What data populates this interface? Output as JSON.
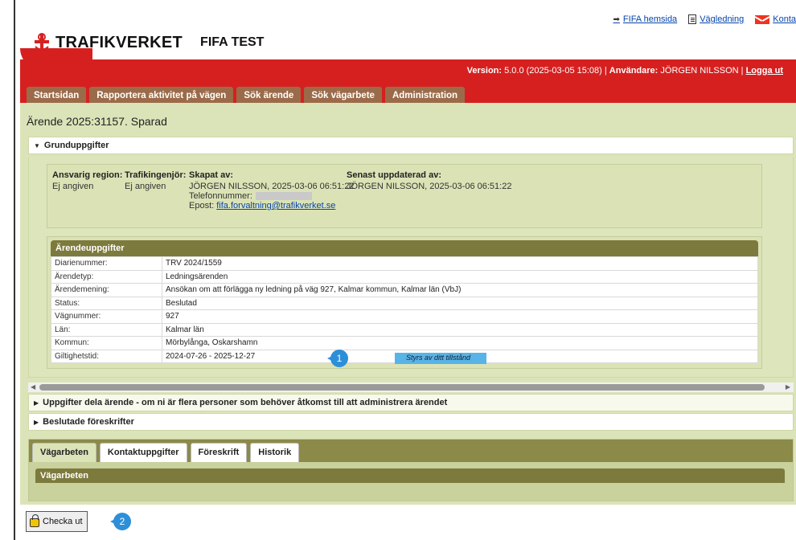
{
  "toplinks": {
    "home": "FIFA hemsida",
    "guide": "Vägledning",
    "contact": "Konta"
  },
  "brand": {
    "logo_text": "TRAFIKVERKET",
    "app_name": "FIFA TEST"
  },
  "header": {
    "version_label": "Version:",
    "version_value": "5.0.0 (2025-03-05 15:08)",
    "separator": "|",
    "user_label": "Användare:",
    "user_value": "JÖRGEN NILSSON",
    "logout": "Logga ut"
  },
  "nav": {
    "tabs": [
      "Startsidan",
      "Rapportera aktivitet på vägen",
      "Sök ärende",
      "Sök vägarbete",
      "Administration"
    ]
  },
  "case": {
    "title": "Ärende 2025:31157. Sparad"
  },
  "basic": {
    "section_title": "Grunduppgifter",
    "region_label": "Ansvarig region:",
    "region_value": "Ej angiven",
    "engineer_label": "Trafikingenjör:",
    "engineer_value": "Ej angiven",
    "created_label": "Skapat av:",
    "created_value": "JÖRGEN NILSSON, 2025-03-06 06:51:22",
    "phone_label": "Telefonnummer:",
    "email_label": "Epost:",
    "email_value": "fifa.forvaltning@trafikverket.se",
    "updated_label": "Senast uppdaterad av:",
    "updated_value": "JÖRGEN NILSSON, 2025-03-06 06:51:22"
  },
  "details": {
    "title": "Ärendeuppgifter",
    "rows": [
      {
        "key": "Diarienummer:",
        "value": "TRV 2024/1559"
      },
      {
        "key": "Ärendetyp:",
        "value": "Ledningsärenden"
      },
      {
        "key": "Ärendemening:",
        "value": "Ansökan om att förlägga ny ledning på väg 927, Kalmar kommun, Kalmar län (VbJ)"
      },
      {
        "key": "Status:",
        "value": "Beslutad"
      },
      {
        "key": "Vägnummer:",
        "value": "927"
      },
      {
        "key": "Län:",
        "value": "Kalmar län"
      },
      {
        "key": "Kommun:",
        "value": "Mörbylånga, Oskarshamn"
      },
      {
        "key": "Giltighetstid:",
        "value": "2024-07-26 - 2025-12-27"
      }
    ],
    "note": "Styrs av ditt tillstånd"
  },
  "sections": {
    "share": "Uppgifter dela ärende - om ni är flera personer som behöver åtkomst till att administrera ärendet",
    "regulations": "Beslutade föreskrifter"
  },
  "lower_tabs": {
    "tabs": [
      "Vägarbeten",
      "Kontaktuppgifter",
      "Föreskrift",
      "Historik"
    ],
    "panel_title": "Vägarbeten"
  },
  "checkout": {
    "label": "Checka ut"
  },
  "badges": {
    "one": "1",
    "two": "2"
  },
  "colors": {
    "brand_red": "#d62020",
    "tab_brown": "#9b6b49",
    "panel_olive": "#7d7a3d",
    "content_bg": "#dbe4b8",
    "badge_blue": "#2d8fd8",
    "note_blue": "#58b3e6"
  }
}
